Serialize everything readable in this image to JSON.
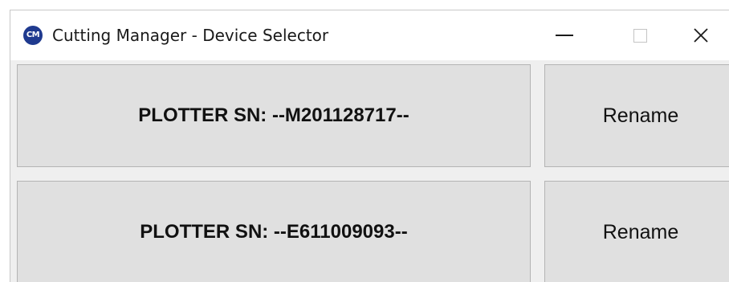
{
  "window": {
    "app_icon_text": "CM",
    "title": "Cutting Manager - Device Selector"
  },
  "devices": [
    {
      "label": "PLOTTER SN: --M201128717--",
      "rename_label": "Rename"
    },
    {
      "label": "PLOTTER SN: --E611009093--",
      "rename_label": "Rename"
    }
  ],
  "icons": {
    "app": "cutting-manager-app-icon",
    "minimize": "minimize-icon",
    "maximize": "maximize-icon",
    "close": "close-icon"
  },
  "colors": {
    "app_icon_bg": "#1f3a8f",
    "button_bg": "#e0e0e0",
    "window_bg": "#efefef"
  }
}
